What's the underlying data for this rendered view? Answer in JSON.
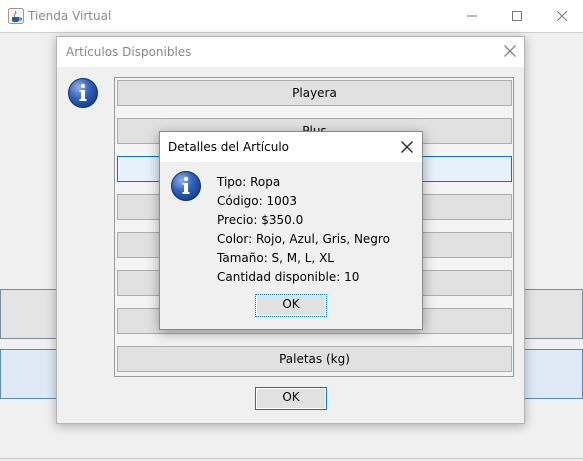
{
  "main_window": {
    "title": "Tienda Virtual",
    "controls": [
      "minimize-icon",
      "maximize-icon",
      "close-icon"
    ]
  },
  "items_dialog": {
    "title": "Artículos Disponibles",
    "items": [
      "Playera",
      "Plus",
      "",
      "",
      "",
      "",
      "",
      "Paletas (kg)"
    ],
    "ok_label": "OK"
  },
  "details_dialog": {
    "title": "Detalles del Artículo",
    "lines": [
      "Tipo: Ropa",
      "Código: 1003",
      "Precio: $350.0",
      "Color: Rojo, Azul, Gris, Negro",
      "Tamaño: S, M, L, XL",
      "Cantidad disponible: 10"
    ],
    "ok_label": "OK"
  },
  "colors": {
    "accent": "#0078d7",
    "info_icon": "#1f4fa8",
    "dialog_bg": "#f0f0f0"
  }
}
